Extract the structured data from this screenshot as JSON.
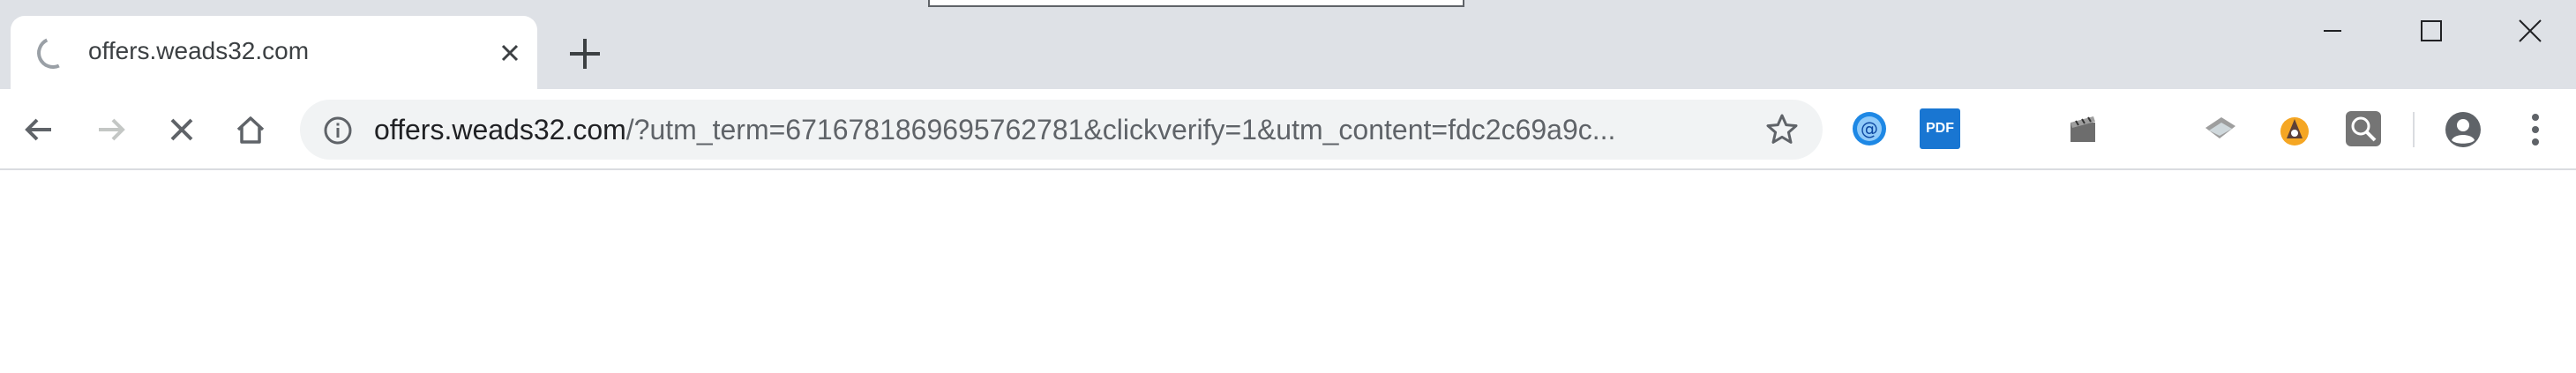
{
  "window": {
    "tab_title": "offers.weads32.com",
    "tab_state": "loading"
  },
  "omnibox": {
    "url_host": "offers.weads32.com",
    "url_rest": "/?utm_term=6716781869695762781&clickverify=1&utm_content=fdc2c69a9c..."
  },
  "icons": {
    "tab_spinner": "loading-spinner-icon",
    "tab_close": "close-icon",
    "new_tab": "plus-icon",
    "minimize": "minimize-icon",
    "maximize": "maximize-icon",
    "close_window": "close-icon",
    "back": "arrow-left-icon",
    "forward": "arrow-right-icon",
    "stop": "close-icon",
    "home": "home-icon",
    "site_info": "info-icon",
    "bookmark": "star-icon",
    "extensions": [
      "email-icon",
      "pdf-icon",
      "clapperboard-icon",
      "ticket-icon",
      "bag-icon",
      "search-icon"
    ],
    "profile": "account-circle-icon",
    "menu": "more-vert-icon"
  },
  "extension_labels": {
    "pdf": "PDF"
  },
  "colors": {
    "tabstrip": "#dee1e6",
    "omnibox": "#f1f3f4",
    "icon": "#5f6368",
    "pdf_badge": "#1976d2",
    "email_badge": "#1e88e5",
    "bag_badge": "#f5a623"
  }
}
